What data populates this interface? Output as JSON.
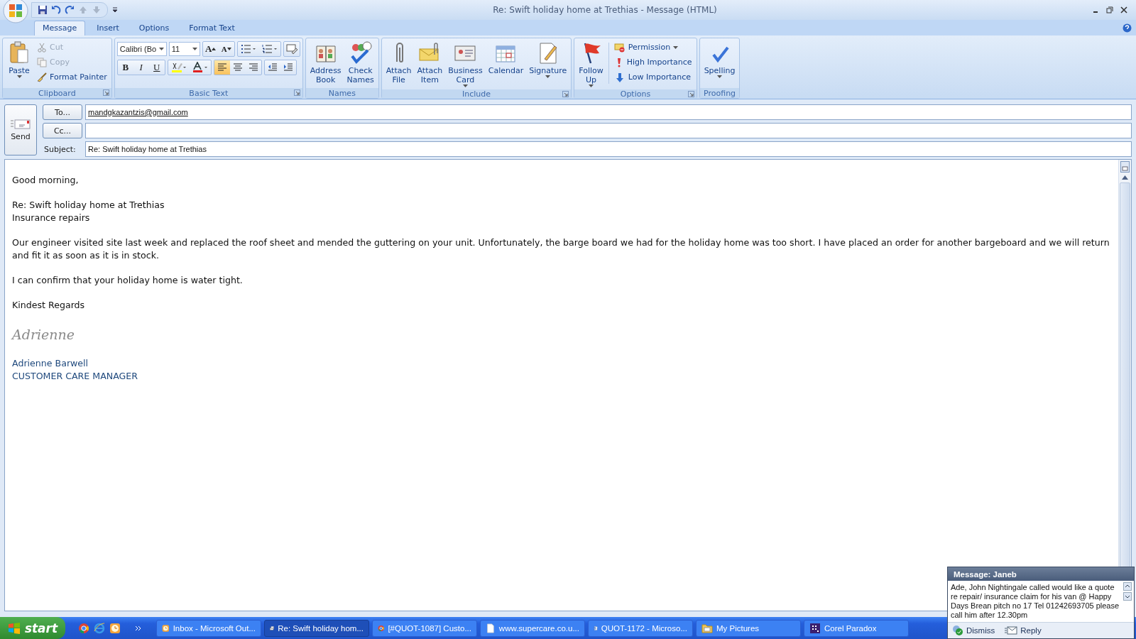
{
  "window": {
    "title": "Re: Swift holiday home at Trethias - Message (HTML)"
  },
  "tabs": [
    {
      "label": "Message",
      "selected": true
    },
    {
      "label": "Insert",
      "selected": false
    },
    {
      "label": "Options",
      "selected": false
    },
    {
      "label": "Format Text",
      "selected": false
    }
  ],
  "clipboard": {
    "label": "Clipboard",
    "paste": "Paste",
    "items": [
      {
        "label": "Cut",
        "disabled": true,
        "kind": "cut"
      },
      {
        "label": "Copy",
        "disabled": true,
        "kind": "copy"
      },
      {
        "label": "Format Painter",
        "disabled": false,
        "kind": "painter"
      }
    ]
  },
  "basic_text": {
    "label": "Basic Text",
    "font": "Calibri (Bo",
    "size": "11",
    "grow": "A",
    "shrink": "A",
    "styles": [
      "B",
      "I",
      "U"
    ],
    "alignment": [
      {
        "selected": true
      },
      {
        "selected": false
      },
      {
        "selected": false
      }
    ]
  },
  "names": {
    "label": "Names",
    "buttons": [
      {
        "lines": [
          "Address",
          "Book"
        ],
        "kind": "book",
        "dropdown": false
      },
      {
        "lines": [
          "Check",
          "Names"
        ],
        "kind": "people",
        "dropdown": false
      }
    ]
  },
  "include": {
    "label": "Include",
    "buttons": [
      {
        "lines": [
          "Attach",
          "File"
        ],
        "kind": "clip",
        "dropdown": false
      },
      {
        "lines": [
          "Attach",
          "Item"
        ],
        "kind": "envelope",
        "dropdown": false
      },
      {
        "lines": [
          "Business",
          "Card"
        ],
        "kind": "card",
        "dropdown": true
      },
      {
        "lines": [
          "Calendar"
        ],
        "kind": "calendar",
        "dropdown": false
      },
      {
        "lines": [
          "Signature"
        ],
        "kind": "pen",
        "dropdown": true
      }
    ]
  },
  "options": {
    "label": "Options",
    "follow_up": {
      "lines": [
        "Follow",
        "Up"
      ],
      "dropdown": true
    },
    "items": [
      {
        "label": "Permission",
        "kind": "permission",
        "dropdown": true
      },
      {
        "label": "High Importance",
        "kind": "high",
        "dropdown": false
      },
      {
        "label": "Low Importance",
        "kind": "low",
        "dropdown": false
      }
    ]
  },
  "proofing": {
    "label": "Proofing",
    "button": {
      "lines": [
        "Spelling"
      ],
      "dropdown": true
    }
  },
  "header": {
    "send": "Send",
    "to_button": "To...",
    "to": "mandgkazantzis@gmail.com",
    "cc_button": "Cc...",
    "subject_label": "Subject:",
    "subject": "Re: Swift holiday home at Trethias"
  },
  "body": [
    {
      "kind": "text",
      "lines": [
        "Good morning,"
      ]
    },
    {
      "kind": "text",
      "lines": [
        "Re: Swift holiday home at Trethias",
        "Insurance repairs"
      ]
    },
    {
      "kind": "text",
      "lines": [
        "Our engineer visited site last week and replaced the roof sheet and mended the guttering on your unit.  Unfortunately, the barge board we had for the holiday home was too short.  I have placed an order for another bargeboard and we will return and fit it as soon as it is in stock."
      ]
    },
    {
      "kind": "text",
      "lines": [
        "I can confirm that your holiday home is water tight."
      ]
    },
    {
      "kind": "text",
      "lines": [
        "Kindest Regards"
      ]
    },
    {
      "kind": "script",
      "lines": [
        "Adrienne"
      ]
    },
    {
      "kind": "signature",
      "lines": [
        "Adrienne Barwell",
        "CUSTOMER CARE MANAGER"
      ]
    }
  ],
  "taskbar": {
    "start": "start",
    "tasks": [
      {
        "label": "Inbox - Microsoft Out...",
        "selected": false
      },
      {
        "label": "Re: Swift holiday hom...",
        "selected": true
      },
      {
        "label": "[#QUOT-1087] Custo...",
        "selected": false
      },
      {
        "label": "www.supercare.co.u...",
        "selected": false
      },
      {
        "label": "QUOT-1172 - Microso...",
        "selected": false
      },
      {
        "label": "My Pictures",
        "selected": false
      },
      {
        "label": "Corel Paradox",
        "selected": false
      }
    ]
  },
  "notification": {
    "title": "Message: Janeb",
    "text": "Ade, John Nightingale  called would like a quote  re repair/ insurance claim for his van @ Happy Days Brean pitch no 17   Tel 01242693705 please call him after 12.30pm",
    "dismiss": "Dismiss",
    "reply": "Reply"
  }
}
